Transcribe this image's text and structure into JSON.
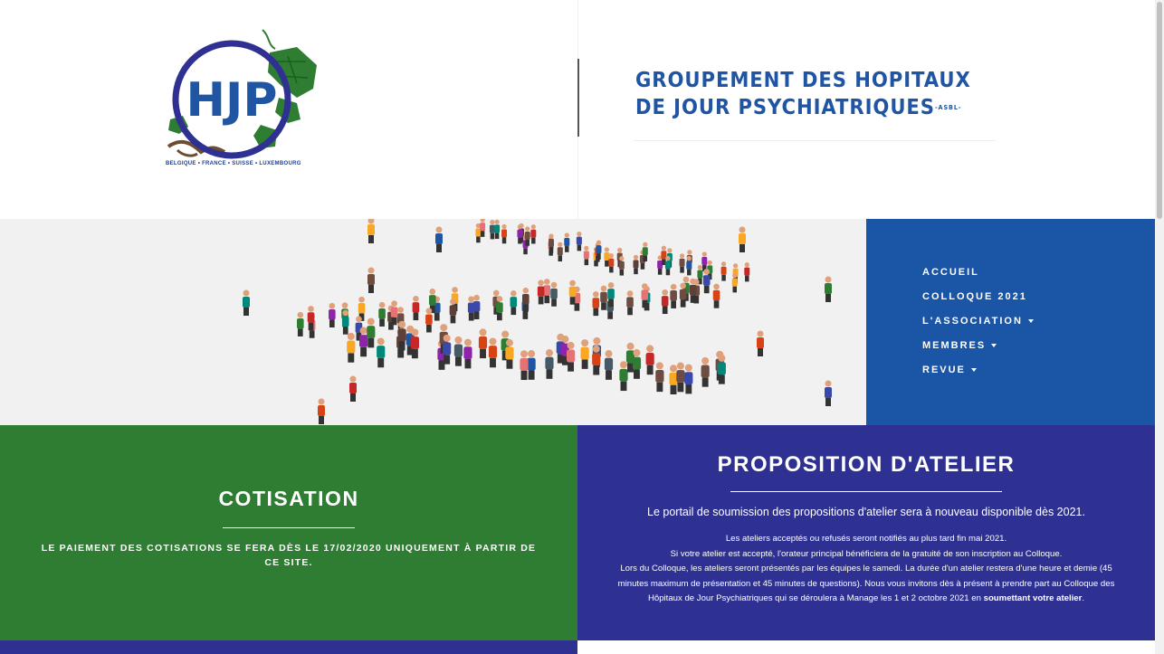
{
  "header": {
    "logo_tagline": "BELGIQUE • FRANCE • SUISSE • LUXEMBOURG",
    "title_line1": "GROUPEMENT DES HOPITAUX",
    "title_line2": "DE JOUR PSYCHIATRIQUES",
    "title_suffix": "-ASBL-"
  },
  "nav": {
    "items": [
      {
        "label": "ACCUEIL",
        "has_caret": false
      },
      {
        "label": "COLLOQUE 2021",
        "has_caret": false
      },
      {
        "label": "L'ASSOCIATION",
        "has_caret": true
      },
      {
        "label": "MEMBRES",
        "has_caret": true
      },
      {
        "label": "REVUE",
        "has_caret": true
      }
    ]
  },
  "cotisation": {
    "title": "COTISATION",
    "text": "LE PAIEMENT DES COTISATIONS SE FERA DÈS LE 17/02/2020 UNIQUEMENT À PARTIR DE CE SITE."
  },
  "atelier": {
    "title": "PROPOSITION D'ATELIER",
    "lead": "Le portail de soumission des propositions d'atelier sera à nouveau disponible dès 2021.",
    "line1": "Les ateliers acceptés ou refusés seront notifiés au plus tard fin mai 2021.",
    "line2": "Si votre atelier est accepté, l'orateur principal bénéficiera de la gratuité de son inscription au Colloque.",
    "line3": "Lors du Colloque, les ateliers seront présentés par les équipes le samedi. La durée d'un atelier restera d'une heure et demie (45 minutes maximum de présentation et 45 minutes de questions). Nous vous invitons dès à présent à prendre part au Colloque des Hôpitaux de Jour Psychiatriques qui se déroulera à Manage les 1 et 2 octobre 2021 en",
    "link": "soumettant votre atelier",
    "end": "."
  },
  "colors": {
    "green": "#2e7d32",
    "purple": "#2e3192",
    "nav_blue": "#1a55a6",
    "title_blue": "#1f55a3"
  }
}
